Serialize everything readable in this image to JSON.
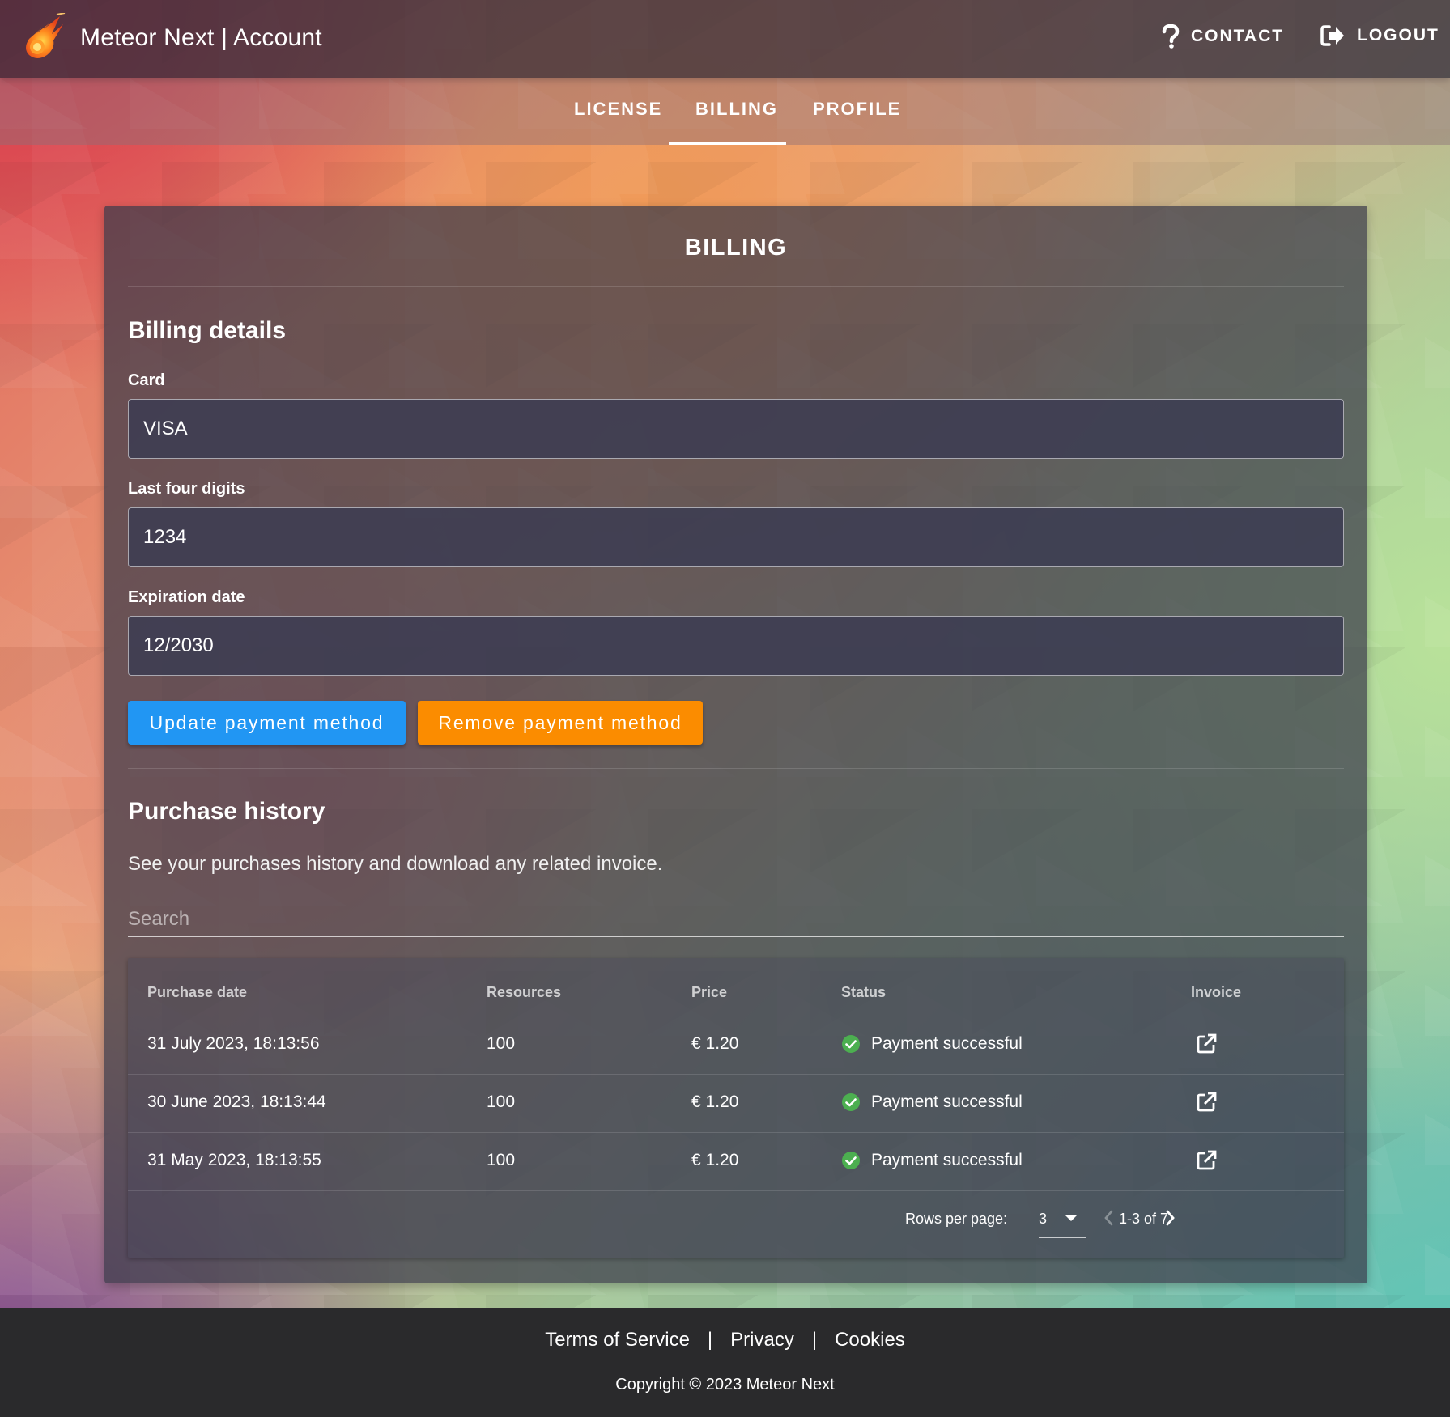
{
  "header": {
    "title": "Meteor Next | Account",
    "contact_label": "CONTACT",
    "logout_label": "LOGOUT"
  },
  "tabs": [
    {
      "label": "LICENSE",
      "active": false
    },
    {
      "label": "BILLING",
      "active": true
    },
    {
      "label": "PROFILE",
      "active": false
    }
  ],
  "card": {
    "title": "BILLING",
    "billing_details": {
      "heading": "Billing details",
      "card_label": "Card",
      "card_value": "VISA",
      "last4_label": "Last four digits",
      "last4_value": "1234",
      "expiration_label": "Expiration date",
      "expiration_value": "12/2030",
      "update_button": "Update payment method",
      "remove_button": "Remove payment method"
    },
    "purchase_history": {
      "heading": "Purchase history",
      "description": "See your purchases history and download any related invoice.",
      "search_placeholder": "Search",
      "columns": [
        "Purchase date",
        "Resources",
        "Price",
        "Status",
        "Invoice"
      ],
      "rows": [
        {
          "date": "31 July 2023, 18:13:56",
          "resources": "100",
          "price": "€ 1.20",
          "status": "Payment successful"
        },
        {
          "date": "30 June 2023, 18:13:44",
          "resources": "100",
          "price": "€ 1.20",
          "status": "Payment successful"
        },
        {
          "date": "31 May 2023, 18:13:55",
          "resources": "100",
          "price": "€ 1.20",
          "status": "Payment successful"
        }
      ],
      "rows_per_page_label": "Rows per page:",
      "rows_per_page_value": "3",
      "range_text": "1-3 of 7"
    }
  },
  "footer": {
    "links": [
      "Terms of Service",
      "Privacy",
      "Cookies"
    ],
    "separator": "|",
    "copyright": "Copyright © 2023 Meteor Next"
  },
  "colors": {
    "primary": "#2196f3",
    "warning": "#fb8c00",
    "success": "#4caf50"
  }
}
